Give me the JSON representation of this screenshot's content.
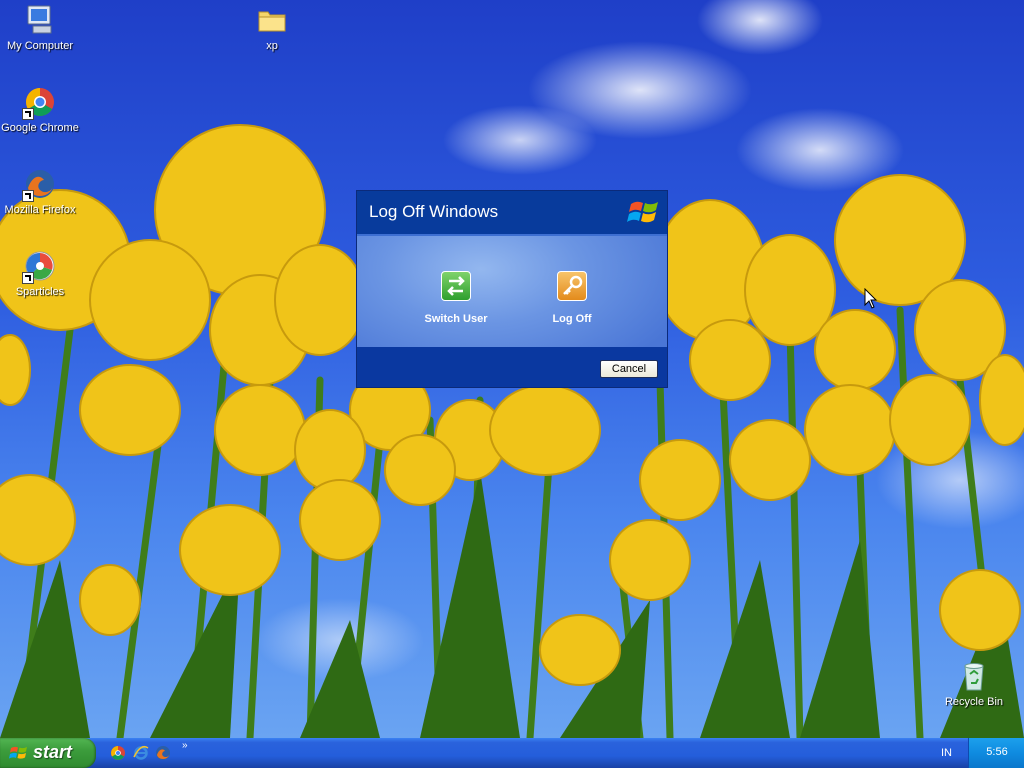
{
  "desktop": {
    "icons": [
      {
        "label": "My Computer",
        "icon": "my-computer-icon"
      },
      {
        "label": "xp",
        "icon": "folder-icon"
      },
      {
        "label": "Google Chrome",
        "icon": "chrome-icon"
      },
      {
        "label": "Mozilla Firefox",
        "icon": "firefox-icon"
      },
      {
        "label": "Sparticles",
        "icon": "sparticles-icon"
      },
      {
        "label": "Recycle Bin",
        "icon": "recycle-bin-icon"
      }
    ]
  },
  "dialog": {
    "title": "Log Off Windows",
    "options": [
      {
        "label": "Switch User",
        "icon": "switch-user-icon"
      },
      {
        "label": "Log Off",
        "icon": "key-icon"
      }
    ],
    "cancel_label": "Cancel"
  },
  "taskbar": {
    "start_label": "start",
    "quick_launch": [
      "chrome-icon",
      "internet-explorer-icon",
      "firefox-icon"
    ],
    "chevron": "»",
    "language": "IN",
    "clock": "5:56"
  },
  "colors": {
    "dialog_blue": "#0a38a0",
    "start_green": "#3c9d3c",
    "taskbar_blue": "#245edb",
    "tray_blue": "#0f8be0"
  }
}
